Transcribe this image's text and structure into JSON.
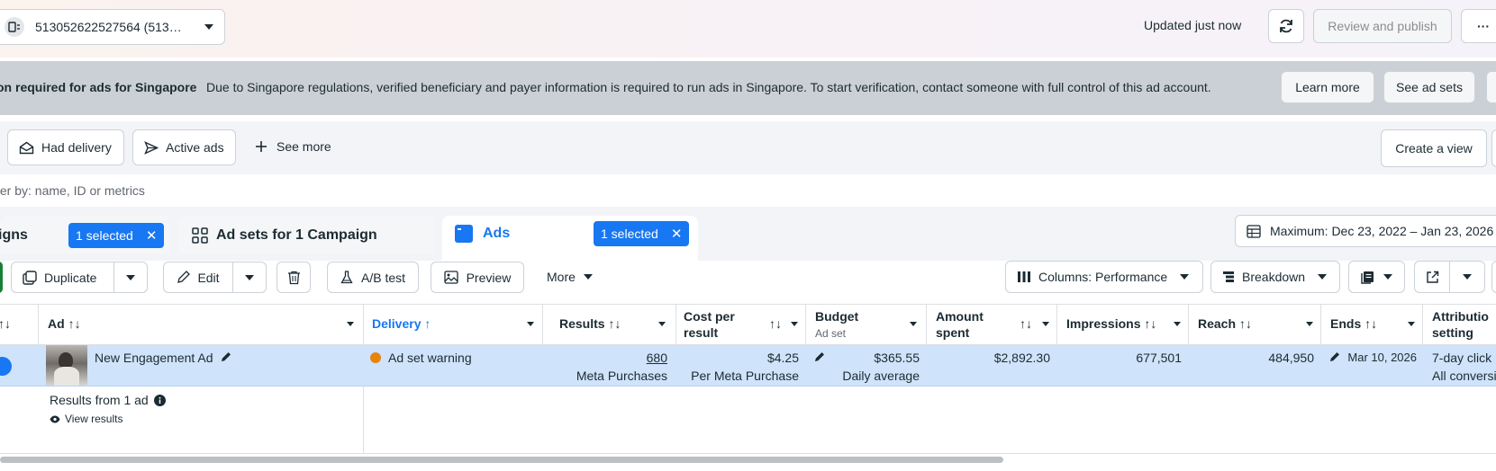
{
  "header": {
    "account_label": "513052622527564 (513…",
    "updated_text": "Updated just now",
    "review_publish_label": "Review and publish",
    "more_label": "···"
  },
  "banner": {
    "title": "on required for ads for Singapore",
    "message": "Due to Singapore regulations, verified beneficiary and payer information is required to run ads in Singapore. To start verification, contact someone with full control of this ad account.",
    "learn_more_label": "Learn more",
    "see_ad_sets_label": "See ad sets"
  },
  "filters": {
    "had_delivery_label": "Had delivery",
    "active_ads_label": "Active ads",
    "see_more_label": "See more",
    "create_view_label": "Create a view",
    "search_placeholder": "ter by: name, ID or metrics"
  },
  "tabs": {
    "campaigns_label": "igns",
    "campaigns_selected": "1 selected",
    "adsets_label": "Ad sets for 1 Campaign",
    "ads_label": "Ads",
    "ads_selected": "1 selected",
    "date_range": "Maximum: Dec 23, 2022 – Jan 23, 2026"
  },
  "toolbar": {
    "duplicate_label": "Duplicate",
    "edit_label": "Edit",
    "ab_test_label": "A/B test",
    "preview_label": "Preview",
    "more_label": "More",
    "columns_label": "Columns: Performance",
    "breakdown_label": "Breakdown"
  },
  "table": {
    "headers": {
      "ad": "Ad",
      "delivery": "Delivery",
      "results": "Results",
      "cost_per_result_1": "Cost per",
      "cost_per_result_2": "result",
      "budget": "Budget",
      "budget_sub": "Ad set",
      "amount_spent_1": "Amount",
      "amount_spent_2": "spent",
      "impressions": "Impressions",
      "reach": "Reach",
      "ends": "Ends",
      "attribution_1": "Attributio",
      "attribution_2": "setting"
    },
    "row": {
      "ad_name": "New Engagement Ad",
      "delivery": "Ad set warning",
      "results": "680",
      "results_sub": "Meta Purchases",
      "cost_per_result": "$4.25",
      "cost_per_result_sub": "Per Meta Purchase",
      "budget": "$365.55",
      "budget_sub": "Daily average",
      "amount_spent": "$2,892.30",
      "impressions": "677,501",
      "reach": "484,950",
      "ends": "Mar 10, 2026",
      "attribution": "7-day click",
      "attribution_sub": "All conversion"
    },
    "summary": {
      "label": "Results from 1 ad",
      "view_results": "View results"
    }
  },
  "colors": {
    "accent": "#1877f2",
    "selected_row": "#cfe3fa",
    "banner_bg": "#cbd0d6",
    "warning_dot": "#e8830c"
  }
}
